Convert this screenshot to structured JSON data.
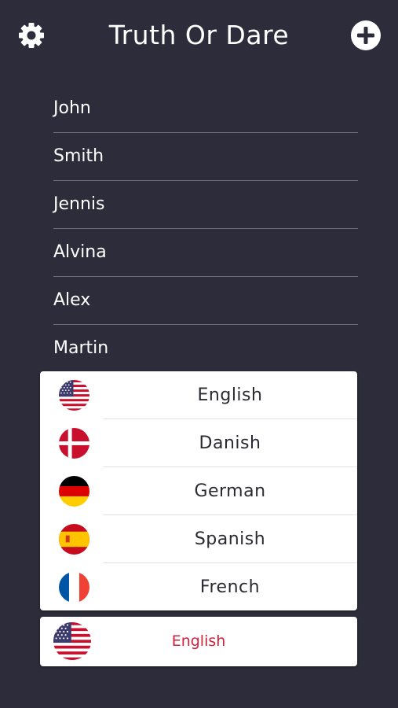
{
  "header": {
    "title": "Truth Or Dare",
    "left_icon": "gear-icon",
    "right_icon": "plus-circle-icon",
    "text_color": "#ffffff"
  },
  "players": [
    "John",
    "Smith",
    "Jennis",
    "Alvina",
    "Alex",
    "Martin"
  ],
  "language_menu": {
    "items": [
      {
        "label": "English",
        "flag": "us-flag-icon"
      },
      {
        "label": "Danish",
        "flag": "denmark-flag-icon"
      },
      {
        "label": "German",
        "flag": "germany-flag-icon"
      },
      {
        "label": "Spanish",
        "flag": "spain-flag-icon"
      },
      {
        "label": "French",
        "flag": "france-flag-icon"
      }
    ]
  },
  "language_select": {
    "selected": "English",
    "flag": "us-flag-icon",
    "text_color": "#d0213a"
  },
  "colors": {
    "background": "#2c2c3a",
    "menu_background": "#ffffff",
    "divider": "#6b6b78"
  }
}
